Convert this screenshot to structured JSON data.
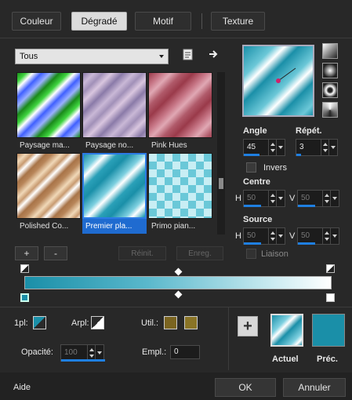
{
  "tabs": [
    "Couleur",
    "Dégradé",
    "Motif",
    "Texture"
  ],
  "category_dropdown": {
    "value": "Tous"
  },
  "thumbnails": [
    {
      "name": "Paysage ma..."
    },
    {
      "name": "Paysage no..."
    },
    {
      "name": "Pink Hues"
    },
    {
      "name": "Polished Co..."
    },
    {
      "name": "Premier pla..."
    },
    {
      "name": "Primo pian..."
    }
  ],
  "library_buttons": {
    "add": "+",
    "remove": "-",
    "reset": "Réinit.",
    "save": "Enreg."
  },
  "angle": {
    "label": "Angle",
    "value": "45"
  },
  "repeat": {
    "label": "Répét.",
    "value": "3"
  },
  "invert": {
    "label": "Invers"
  },
  "center": {
    "label": "Centre",
    "h_label": "H",
    "h_value": "50",
    "v_label": "V",
    "v_value": "50"
  },
  "source": {
    "label": "Source",
    "h_label": "H",
    "h_value": "50",
    "v_label": "V",
    "v_value": "50"
  },
  "link": {
    "label": "Liaison"
  },
  "stop_props": {
    "arpl_label": "1pl:",
    "arrpl_label": "Arpl:",
    "util_label": "Util.:",
    "opacity_label": "Opacité:",
    "opacity_value": "100",
    "location_label": "Empl.:",
    "location_value": "0",
    "util_color_1": "#7a6420",
    "util_color_2": "#8a7426"
  },
  "preview": {
    "current_label": "Actuel",
    "previous_label": "Préc.",
    "prev_color": "#1a8fa8"
  },
  "footer": {
    "help": "Aide",
    "ok": "OK",
    "cancel": "Annuler"
  },
  "colors": {
    "accent": "#1f6bd0",
    "teal": "#1a8fa8",
    "bg": "#282828"
  }
}
